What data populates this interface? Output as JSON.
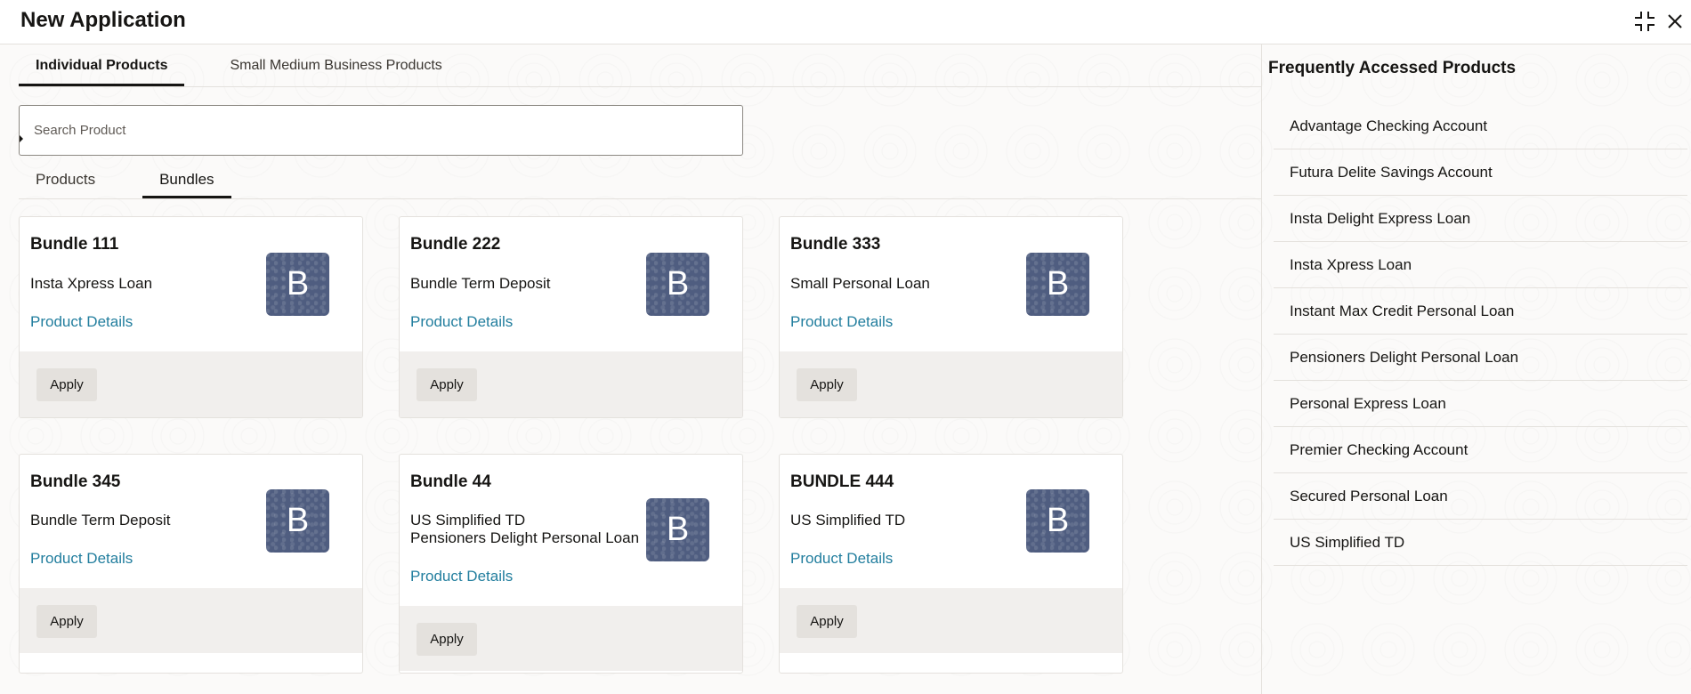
{
  "header": {
    "title": "New Application",
    "icons": [
      "collapse-icon",
      "close-icon"
    ]
  },
  "tabs": {
    "top": [
      "Individual Products",
      "Small Medium Business Products"
    ],
    "top_active": 0,
    "sub": [
      "Products",
      "Bundles"
    ],
    "sub_active": 1
  },
  "search": {
    "placeholder": "Search Product",
    "value": ""
  },
  "cards": [
    {
      "title": "Bundle 111",
      "desc": [
        "Insta Xpress Loan"
      ],
      "link": "Product Details",
      "button": "Apply",
      "avatar": "B"
    },
    {
      "title": "Bundle 222",
      "desc": [
        "Bundle Term Deposit"
      ],
      "link": "Product Details",
      "button": "Apply",
      "avatar": "B"
    },
    {
      "title": "Bundle 333",
      "desc": [
        "Small Personal Loan"
      ],
      "link": "Product Details",
      "button": "Apply",
      "avatar": "B"
    },
    {
      "title": "Bundle 345",
      "desc": [
        "Bundle Term Deposit"
      ],
      "link": "Product Details",
      "button": "Apply",
      "avatar": "B"
    },
    {
      "title": "Bundle 44",
      "desc": [
        "US Simplified TD",
        "Pensioners Delight Personal Loan"
      ],
      "link": "Product Details",
      "button": "Apply",
      "avatar": "B"
    },
    {
      "title": "BUNDLE 444",
      "desc": [
        "US Simplified TD"
      ],
      "link": "Product Details",
      "button": "Apply",
      "avatar": "B"
    }
  ],
  "sidebar": {
    "title": "Frequently Accessed Products",
    "items": [
      "Advantage Checking Account",
      "Futura Delite Savings Account",
      "Insta Delight Express Loan",
      "Insta Xpress Loan",
      "Instant Max Credit Personal Loan",
      "Pensioners Delight Personal Loan",
      "Personal Express Loan",
      "Premier Checking Account",
      "Secured Personal Loan",
      "US Simplified TD"
    ]
  }
}
